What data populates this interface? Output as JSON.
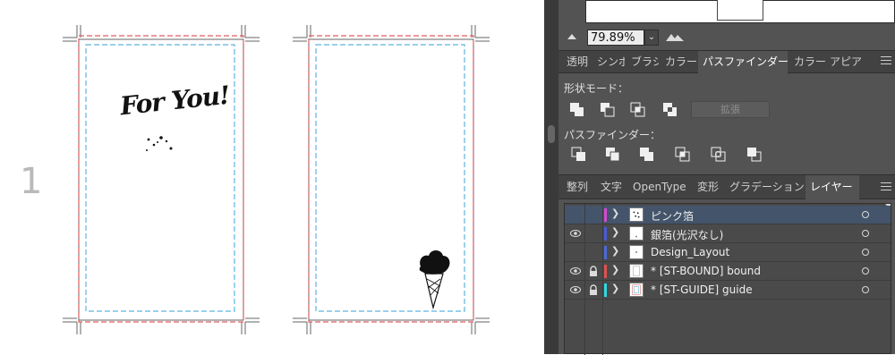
{
  "canvas": {
    "page_number": "1",
    "artboard1_text": "For You!"
  },
  "colors": {
    "bleed": "#e05c61",
    "safe": "#5cb3e0",
    "trim": "#666666",
    "panel_bg": "#535353",
    "selected_row": "#44556b"
  },
  "navigator": {
    "zoom": "79.89%"
  },
  "tabs_top": [
    {
      "label": "透明"
    },
    {
      "label": "シンボ"
    },
    {
      "label": "ブラシ"
    },
    {
      "label": "カラー"
    },
    {
      "label": "パスファインダー"
    },
    {
      "label": "カラー"
    },
    {
      "label": "アピア"
    }
  ],
  "pathfinder": {
    "shape_modes_label": "形状モード：",
    "pathfinders_label": "パスファインダー：",
    "expand_label": "拡張"
  },
  "tabs_bottom": [
    {
      "label": "整列"
    },
    {
      "label": "文字"
    },
    {
      "label": "OpenType"
    },
    {
      "label": "変形"
    },
    {
      "label": "グラデーション"
    },
    {
      "label": "レイヤー"
    }
  ],
  "layers": [
    {
      "name": "ピンク箔",
      "color": "#d24ad2",
      "visible": false,
      "locked": false,
      "selected": true
    },
    {
      "name": "銀箔(光沢なし)",
      "color": "#4a5ad8",
      "visible": true,
      "locked": false,
      "selected": false
    },
    {
      "name": "Design_Layout",
      "color": "#4a6ad8",
      "visible": false,
      "locked": false,
      "selected": false
    },
    {
      "name": "* [ST-BOUND] bound",
      "color": "#e05050",
      "visible": true,
      "locked": true,
      "selected": false
    },
    {
      "name": "* [ST-GUIDE] guide",
      "color": "#30d8e0",
      "visible": true,
      "locked": true,
      "selected": false
    }
  ]
}
